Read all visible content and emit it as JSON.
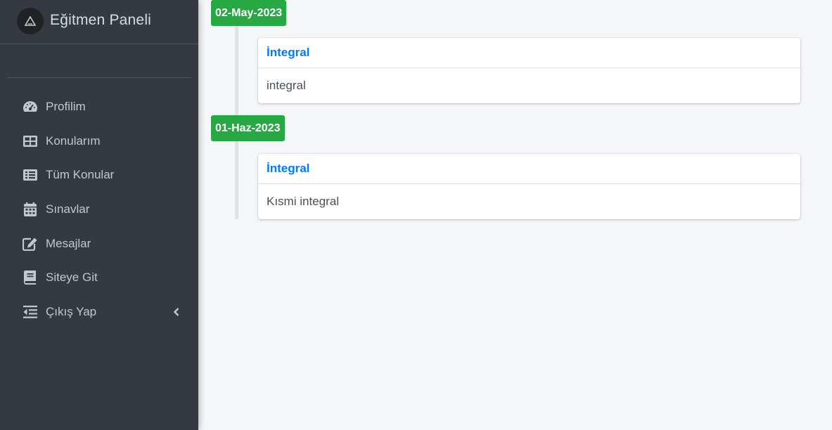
{
  "brand": {
    "title": "Eğitmen Paneli"
  },
  "sidebar": {
    "items": [
      {
        "label": "Profilim",
        "icon": "dashboard-icon"
      },
      {
        "label": "Konularım",
        "icon": "table-icon"
      },
      {
        "label": "Tüm Konular",
        "icon": "list-icon"
      },
      {
        "label": "Sınavlar",
        "icon": "calendar-icon"
      },
      {
        "label": "Mesajlar",
        "icon": "edit-icon"
      },
      {
        "label": "Siteye Git",
        "icon": "book-icon"
      },
      {
        "label": "Çıkış Yap",
        "icon": "outdent-icon"
      }
    ]
  },
  "timeline": {
    "groups": [
      {
        "date": "02-May-2023",
        "title": "İntegral",
        "body": "integral"
      },
      {
        "date": "01-Haz-2023",
        "title": "İntegral",
        "body": "Kısmi integral"
      }
    ]
  },
  "colors": {
    "sidebar": "#343a40",
    "accent_green": "#28a745",
    "link_blue": "#007bff",
    "background": "#f4f6f9"
  }
}
